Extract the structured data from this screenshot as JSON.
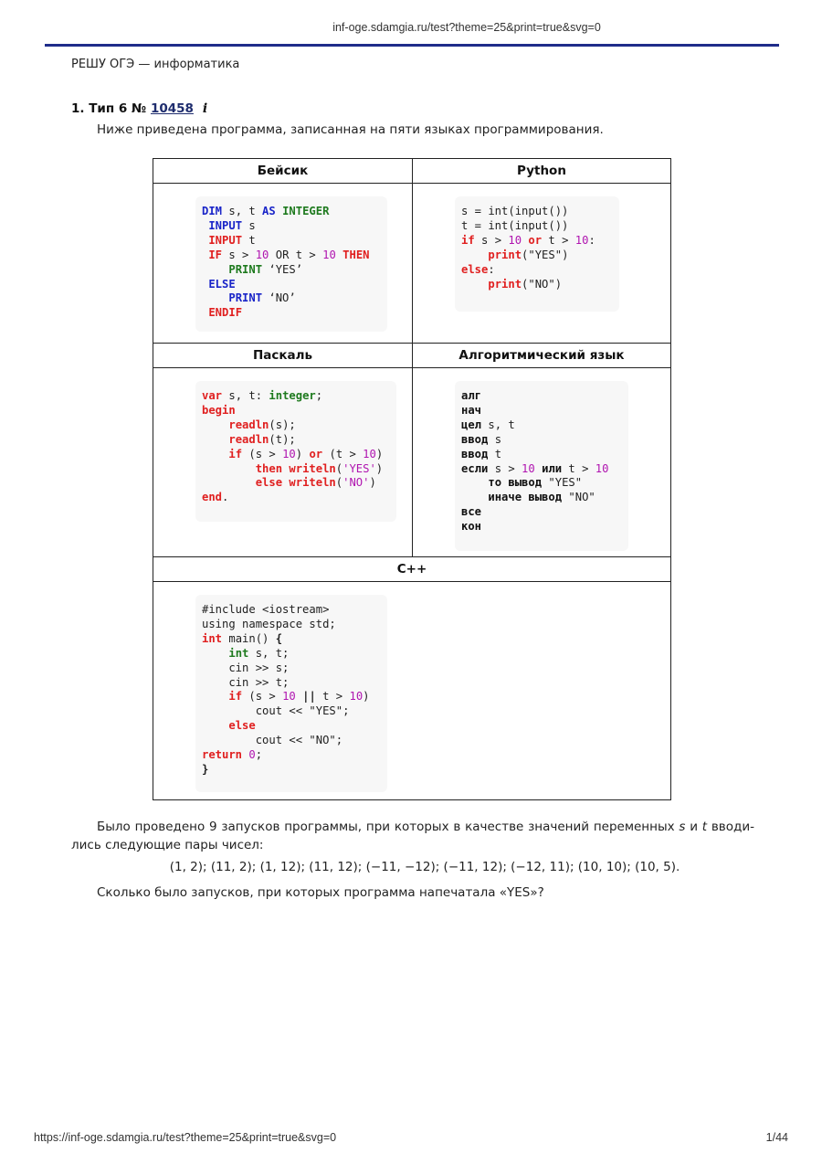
{
  "header": {
    "url": "inf-oge.sdamgia.ru/test?theme=25&print=true&svg=0"
  },
  "site_title": "РЕШУ ОГЭ — информатика",
  "task": {
    "prefix": "1. Тип 6 № ",
    "number": "10458",
    "info": "i",
    "intro": "Ниже приведена программа, записанная на пяти языках программирования."
  },
  "languages": {
    "basic": "Бейсик",
    "python": "Python",
    "pascal": "Паскаль",
    "algo": "Алгоритмический язык",
    "cpp": "C++"
  },
  "paragraph": {
    "before_s": "Было проведено 9 запусков программы, при которых в качестве значений переменных ",
    "var_s": "s",
    "and": " и ",
    "var_t": "t",
    "after_t": " вводи­лись следующие пары чисел:"
  },
  "pairs": "(1, 2); (11, 2); (1, 12); (11, 12); (−11, −12); (−11, 12); (−12, 11); (10, 10); (10, 5).",
  "question": "Сколько было запусков, при которых программа напечатала «YES»?",
  "footer": {
    "url": "https://inf-oge.sdamgia.ru/test?theme=25&print=true&svg=0",
    "page": "1/44"
  }
}
